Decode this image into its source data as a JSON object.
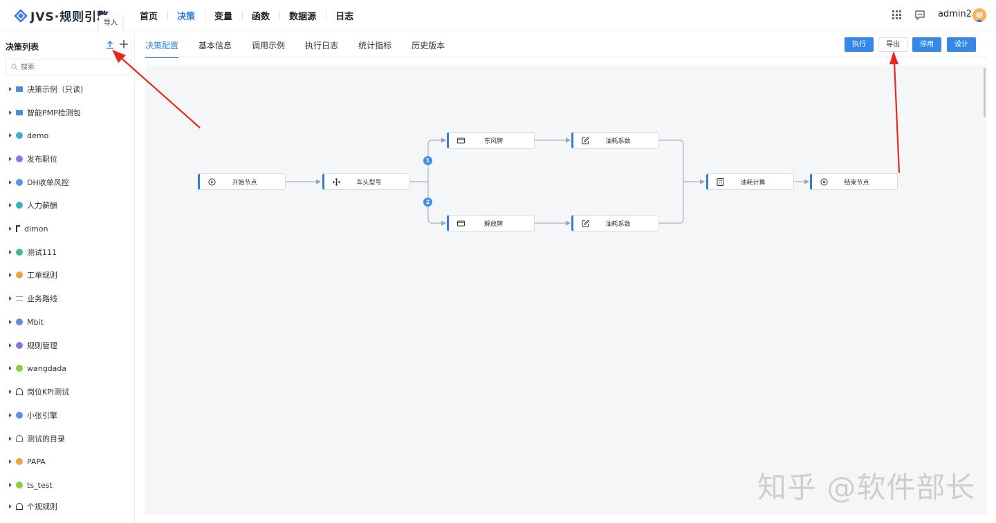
{
  "app": {
    "logo_text": "JVS·规则引擎",
    "tooltip": "导入",
    "nav": [
      "首页",
      "决策",
      "变量",
      "函数",
      "数据源",
      "日志"
    ],
    "active_nav": 1,
    "username": "admin2"
  },
  "sidebar": {
    "title": "决策列表",
    "search_placeholder": "搜索",
    "items": [
      {
        "label": "决策示例（只读)",
        "icon": "folder-icon",
        "color": "#4a90e2"
      },
      {
        "label": "智能PMP检测包",
        "icon": "folder-icon",
        "color": "#4a90e2"
      },
      {
        "label": "demo",
        "icon": "circle-icon",
        "color": "#36b3c9"
      },
      {
        "label": "发布职位",
        "icon": "circle-icon",
        "color": "#7b7fe0"
      },
      {
        "label": "DH收单风控",
        "icon": "circle-icon",
        "color": "#5d8ee6"
      },
      {
        "label": "人力薪酬",
        "icon": "circle-icon",
        "color": "#36b3c9"
      },
      {
        "label": "dimon",
        "icon": "branch-icon",
        "color": "#333333"
      },
      {
        "label": "测试111",
        "icon": "circle-icon",
        "color": "#3dbd8a"
      },
      {
        "label": "工单规则",
        "icon": "circle-icon",
        "color": "#f0a040"
      },
      {
        "label": "业务路线",
        "icon": "list-icon",
        "color": "#888888"
      },
      {
        "label": "Mbit",
        "icon": "circle-icon",
        "color": "#5d8ee6"
      },
      {
        "label": "规则管理",
        "icon": "circle-icon",
        "color": "#7b7fe0"
      },
      {
        "label": "wangdada",
        "icon": "circle-icon",
        "color": "#8ccc3c"
      },
      {
        "label": "岗位KPI测试",
        "icon": "home-icon",
        "color": "#333333"
      },
      {
        "label": "小张引擎",
        "icon": "circle-icon",
        "color": "#5d8ee6"
      },
      {
        "label": "测试的目录",
        "icon": "user-icon",
        "color": "#555555"
      },
      {
        "label": "PAPA",
        "icon": "circle-icon",
        "color": "#f0a040"
      },
      {
        "label": "ts_test",
        "icon": "circle-icon",
        "color": "#8ccc3c"
      },
      {
        "label": "个规规则",
        "icon": "home-icon",
        "color": "#333333"
      }
    ]
  },
  "tabs": [
    "决策配置",
    "基本信息",
    "调用示例",
    "执行日志",
    "统计指标",
    "历史版本"
  ],
  "active_tab": 0,
  "actions": {
    "execute": "执行",
    "export": "导出",
    "disable": "停用",
    "design": "设计"
  },
  "flow": {
    "nodes": {
      "start": "开始节点",
      "truck_model": "车头型号",
      "dongfeng": "东风牌",
      "fuel_coef_1": "油耗系数",
      "jiefang": "解放牌",
      "fuel_coef_2": "油耗系数",
      "fuel_calc": "油耗计算",
      "end": "结束节点"
    },
    "branches": [
      "1",
      "2"
    ]
  },
  "watermark": "知乎 @软件部长",
  "colors": {
    "accent": "#2f7de1",
    "arrow": "#e8281e"
  }
}
